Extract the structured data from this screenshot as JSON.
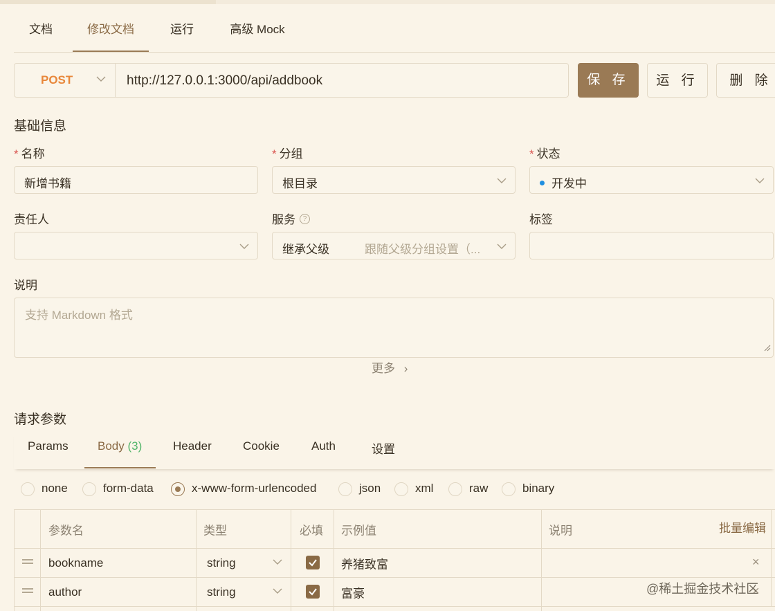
{
  "top_tabs": [
    {
      "label": "文档"
    },
    {
      "label": "修改文档"
    },
    {
      "label": "运行"
    },
    {
      "label": "高级 Mock"
    }
  ],
  "request": {
    "method": "POST",
    "url": "http://127.0.0.1:3000/api/addbook",
    "save_label": "保 存",
    "run_label": "运 行",
    "delete_label": "删 除"
  },
  "basic_info": {
    "title": "基础信息",
    "name_label": "名称",
    "name_value": "新增书籍",
    "group_label": "分组",
    "group_value": "根目录",
    "status_label": "状态",
    "status_value": "开发中",
    "status_color": "#1e8ee0",
    "owner_label": "责任人",
    "owner_value": "",
    "service_label": "服务",
    "service_value": "继承父级",
    "service_hint": "跟随父级分组设置（...",
    "tags_label": "标签",
    "tags_value": "",
    "desc_label": "说明",
    "desc_placeholder": "支持 Markdown 格式",
    "more_label": "更多"
  },
  "request_params": {
    "title": "请求参数",
    "tabs": [
      {
        "label": "Params"
      },
      {
        "label": "Body",
        "count": "(3)"
      },
      {
        "label": "Header"
      },
      {
        "label": "Cookie"
      },
      {
        "label": "Auth"
      },
      {
        "label": "设置"
      }
    ],
    "body_types": [
      "none",
      "form-data",
      "x-www-form-urlencoded",
      "json",
      "xml",
      "raw",
      "binary"
    ],
    "selected_body_type": "x-www-form-urlencoded",
    "table": {
      "headers": [
        "参数名",
        "类型",
        "必填",
        "示例值",
        "说明"
      ],
      "batch_edit_label": "批量编辑",
      "rows": [
        {
          "name": "bookname",
          "type": "string",
          "required": true,
          "example": "养猪致富",
          "desc": ""
        },
        {
          "name": "author",
          "type": "string",
          "required": true,
          "example": "富豪",
          "desc": ""
        }
      ]
    }
  },
  "watermark": "@稀土掘金技术社区",
  "colors": {
    "accent": "#9a7a55",
    "method_post": "#e8873a",
    "background": "#faf4e8",
    "required_star": "#d9534f",
    "count_green": "#52b56a"
  }
}
